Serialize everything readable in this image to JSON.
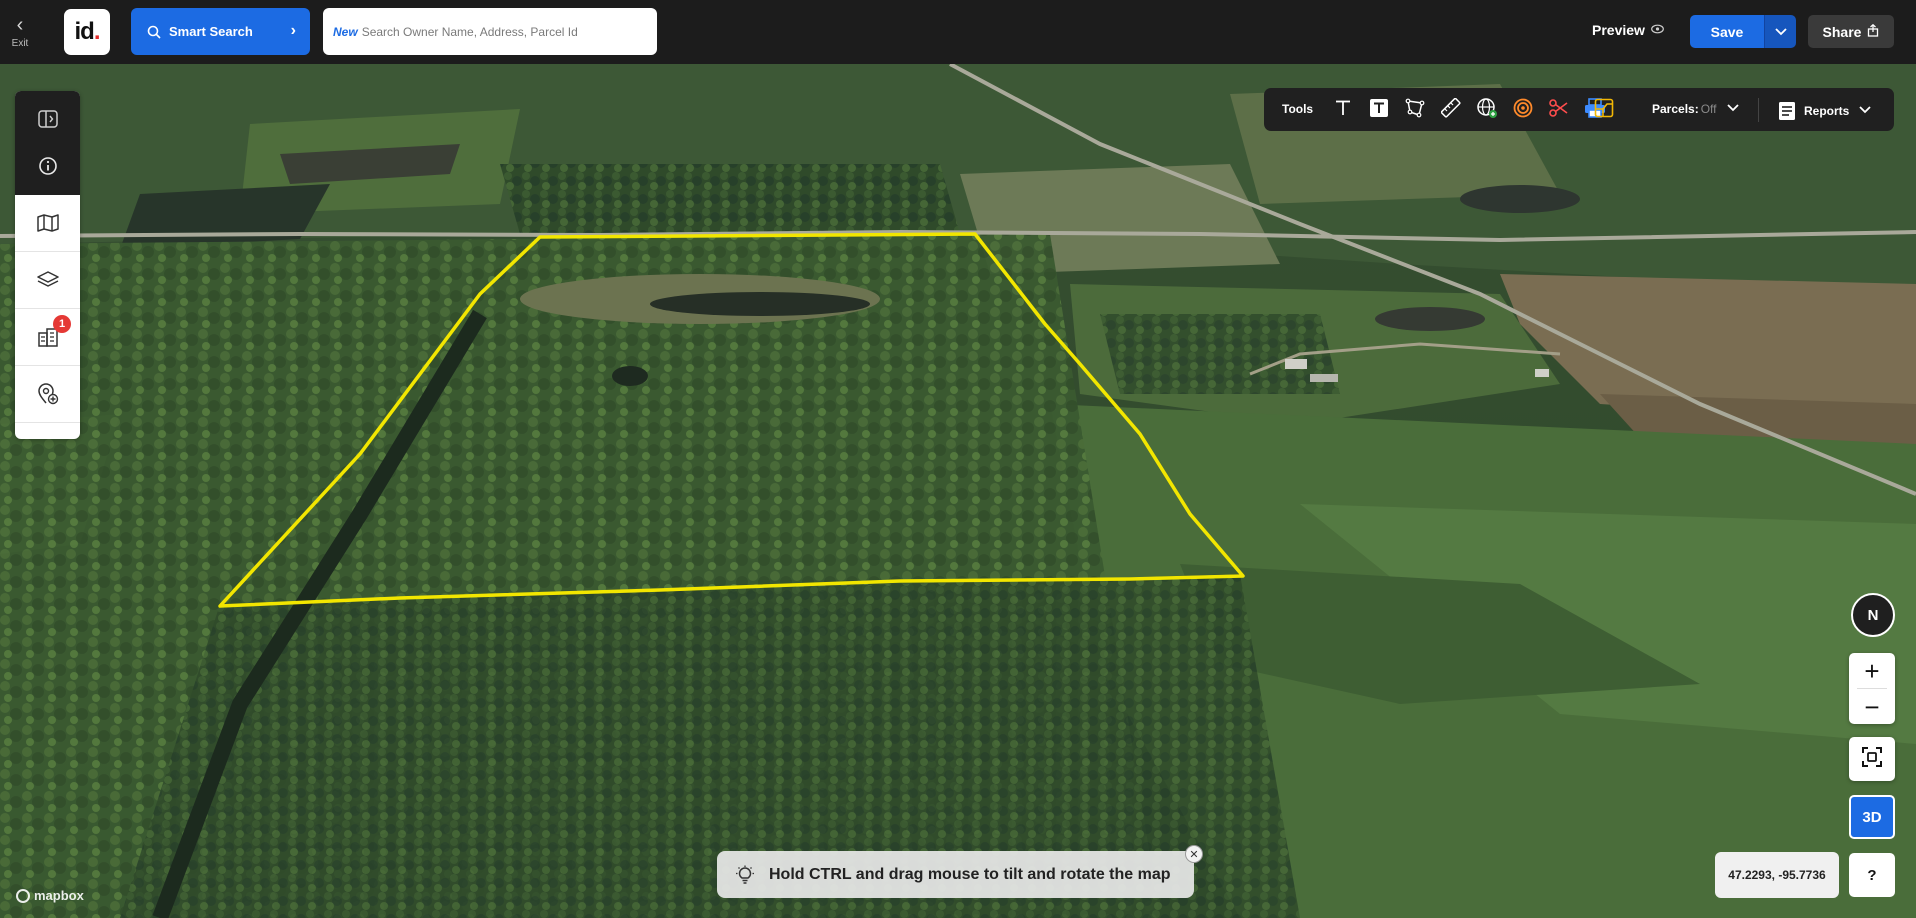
{
  "header": {
    "exit_label": "Exit",
    "logo_text": "id",
    "smart_search_label": "Smart Search",
    "search_new_tag": "New",
    "search_placeholder": "Search Owner Name, Address, Parcel Id",
    "preview_label": "Preview",
    "save_label": "Save",
    "share_label": "Share"
  },
  "sidebar": {
    "notification_count": "1"
  },
  "toolbar": {
    "tools_label": "Tools",
    "parcels_label": "Parcels:",
    "parcels_state": "Off",
    "reports_label": "Reports"
  },
  "map": {
    "boundary_color": "#f2e600",
    "coordinates": "47.2293, -95.7736",
    "compass_label": "N",
    "three_d_label": "3D",
    "help_label": "?",
    "zoom_in": "+",
    "zoom_out": "−",
    "attribution": "mapbox"
  },
  "hint": {
    "text": "Hold CTRL and drag mouse to tilt and rotate the map"
  },
  "colors": {
    "accent": "#1c6be3",
    "topbar": "#1c1c1c",
    "badge": "#e53935"
  }
}
